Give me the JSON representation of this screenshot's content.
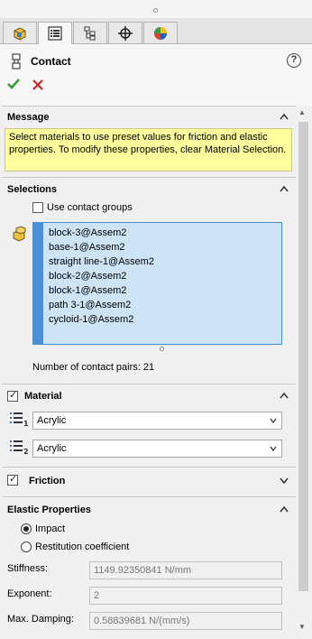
{
  "tabs": [
    {
      "icon": "feature-manager-icon",
      "active": false
    },
    {
      "icon": "property-manager-icon",
      "active": true
    },
    {
      "icon": "configuration-manager-icon",
      "active": false
    },
    {
      "icon": "dimxpert-icon",
      "active": false
    },
    {
      "icon": "display-manager-icon",
      "active": false
    }
  ],
  "header": {
    "title": "Contact",
    "help": "?"
  },
  "message": {
    "heading": "Message",
    "text": "Select materials to use preset values for friction and elastic properties. To modify these properties, clear Material Selection."
  },
  "selections": {
    "heading": "Selections",
    "use_contact_groups": "Use contact groups",
    "items": [
      "block-3@Assem2",
      "base-1@Assem2",
      "straight line-1@Assem2",
      "block-2@Assem2",
      "block-1@Assem2",
      "path 3-1@Assem2",
      "cycloid-1@Assem2"
    ],
    "contact_pairs": "Number of contact pairs: 21"
  },
  "material": {
    "heading": "Material",
    "material1": "Acrylic",
    "material2": "Acrylic"
  },
  "friction": {
    "heading": "Friction"
  },
  "elastic": {
    "heading": "Elastic Properties",
    "impact": "Impact",
    "restitution": "Restitution coefficient",
    "stiffness_label": "Stiffness:",
    "stiffness_value": "1149.92350841 N/mm",
    "exponent_label": "Exponent:",
    "exponent_value": "2",
    "max_damping_label": "Max. Damping:",
    "max_damping_value": "0.58839681 N/(mm/s)"
  },
  "colors": {
    "accent": "#4a90d9",
    "message_bg": "#ffff9d",
    "ok": "#2e9e2e",
    "cancel": "#cc2222"
  }
}
